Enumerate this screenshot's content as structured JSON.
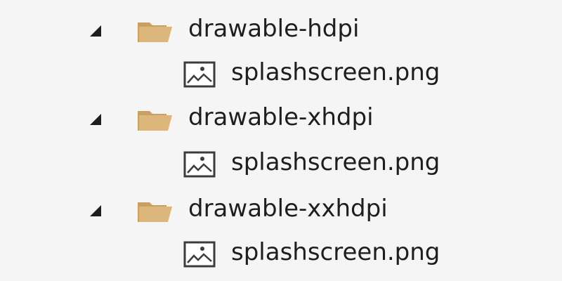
{
  "tree": {
    "nodes": [
      {
        "folder": "drawable-hdpi",
        "expanded": true,
        "children": [
          {
            "file": "splashscreen.png"
          }
        ]
      },
      {
        "folder": "drawable-xhdpi",
        "expanded": true,
        "children": [
          {
            "file": "splashscreen.png"
          }
        ]
      },
      {
        "folder": "drawable-xxhdpi",
        "expanded": true,
        "children": [
          {
            "file": "splashscreen.png"
          }
        ]
      }
    ]
  },
  "icons": {
    "expander": "expanded-triangle-icon",
    "folder": "folder-icon",
    "file": "image-file-icon"
  },
  "colors": {
    "background": "#f5f5f5",
    "text": "#1e1e1e",
    "expander": "#1e1e1e",
    "folder_fill": "#dcb67a",
    "folder_back": "#c8a063",
    "image_icon_stroke": "#3c3c3c"
  }
}
